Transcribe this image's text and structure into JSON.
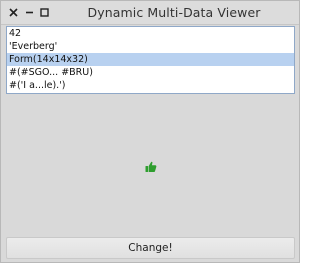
{
  "window": {
    "title": "Dynamic Multi-Data Viewer"
  },
  "list": {
    "items": [
      {
        "label": "42"
      },
      {
        "label": "'Everberg'"
      },
      {
        "label": "Form(14x14x32)"
      },
      {
        "label": "#(#SGO... #BRU)"
      },
      {
        "label": "#('I a...le).')"
      }
    ],
    "selected_index": 2
  },
  "viewer": {
    "icon": "thumbs-up-icon",
    "icon_color": "#2e9e2e"
  },
  "buttons": {
    "change_label": "Change!"
  }
}
